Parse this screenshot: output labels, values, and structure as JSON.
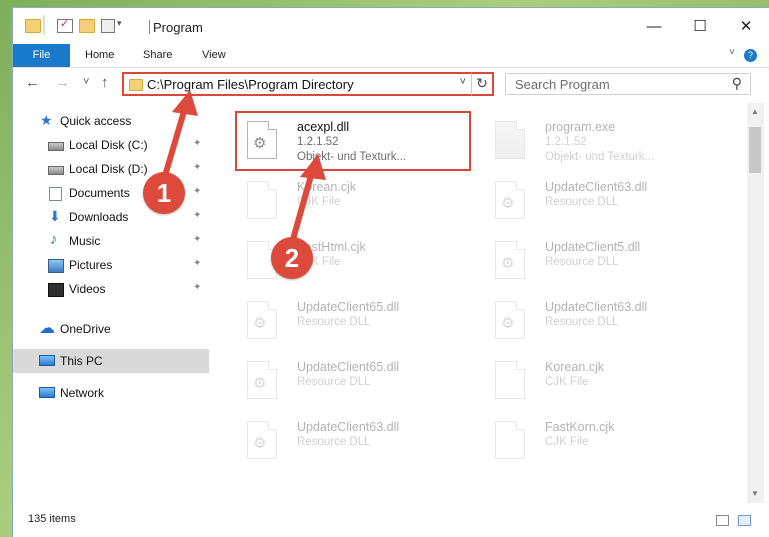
{
  "window": {
    "title": "Program",
    "controls": {
      "minimize": "—",
      "maximize": "☐",
      "close": "✕"
    }
  },
  "ribbon": {
    "tabs": [
      "File",
      "Home",
      "Share",
      "View"
    ],
    "help": "?"
  },
  "navigation": {
    "back": "←",
    "forward": "→",
    "recent": "˅",
    "up": "↑",
    "address": "C:\\Program Files\\Program Directory",
    "address_dropdown": "˅",
    "refresh": "↻",
    "search_placeholder": "Search Program",
    "search_icon": "⚲"
  },
  "sidebar": {
    "items": [
      {
        "label": "Quick access",
        "icon": "star-icon",
        "pinned": false
      },
      {
        "label": "Local Disk (C:)",
        "icon": "drive-icon",
        "pinned": true
      },
      {
        "label": "Local Disk (D:)",
        "icon": "drive-icon",
        "pinned": true
      },
      {
        "label": "Documents",
        "icon": "documents-icon",
        "pinned": true
      },
      {
        "label": "Downloads",
        "icon": "download-icon",
        "pinned": true
      },
      {
        "label": "Music",
        "icon": "music-icon",
        "pinned": true
      },
      {
        "label": "Pictures",
        "icon": "pictures-icon",
        "pinned": true
      },
      {
        "label": "Videos",
        "icon": "videos-icon",
        "pinned": true
      },
      {
        "label": "OneDrive",
        "icon": "cloud-icon",
        "pinned": false
      },
      {
        "label": "This PC",
        "icon": "computer-icon",
        "pinned": false
      },
      {
        "label": "Network",
        "icon": "network-icon",
        "pinned": false
      }
    ],
    "pin_glyph": "📌"
  },
  "files": [
    {
      "name": "acexpl.dll",
      "line1": "1.2.1.52",
      "line2": "Objekt- und Texturk...",
      "faded": false,
      "highlighted": true
    },
    {
      "name": "program.exe",
      "line1": "1.2.1.52",
      "line2": "Objekt- und Texturk...",
      "faded": true,
      "highlighted": false
    },
    {
      "name": "Korean.cjk",
      "line1": "CJK File",
      "line2": "",
      "faded": true,
      "highlighted": false
    },
    {
      "name": "UpdateClient63.dll",
      "line1": "Resource DLL",
      "line2": "",
      "faded": true,
      "highlighted": false
    },
    {
      "name": "FastHtml.cjk",
      "line1": "CJK File",
      "line2": "",
      "faded": true,
      "highlighted": false
    },
    {
      "name": "UpdateClient5.dll",
      "line1": "Resource DLL",
      "line2": "",
      "faded": true,
      "highlighted": false
    },
    {
      "name": "UpdateClient65.dll",
      "line1": "Resource DLL",
      "line2": "",
      "faded": true,
      "highlighted": false
    },
    {
      "name": "UpdateClient63.dll",
      "line1": "Resource DLL",
      "line2": "",
      "faded": true,
      "highlighted": false
    },
    {
      "name": "UpdateClient65.dll",
      "line1": "Resource DLL",
      "line2": "",
      "faded": true,
      "highlighted": false
    },
    {
      "name": "Korean.cjk",
      "line1": "CJK File",
      "line2": "",
      "faded": true,
      "highlighted": false
    },
    {
      "name": "UpdateClient63.dll",
      "line1": "Resource DLL",
      "line2": "",
      "faded": true,
      "highlighted": false
    },
    {
      "name": "FastKorn.cjk",
      "line1": "CJK File",
      "line2": "",
      "faded": true,
      "highlighted": false
    }
  ],
  "status": {
    "item_count": "135 items"
  },
  "annotations": {
    "step1": "1",
    "step2": "2",
    "color": "#dd4a3c"
  }
}
